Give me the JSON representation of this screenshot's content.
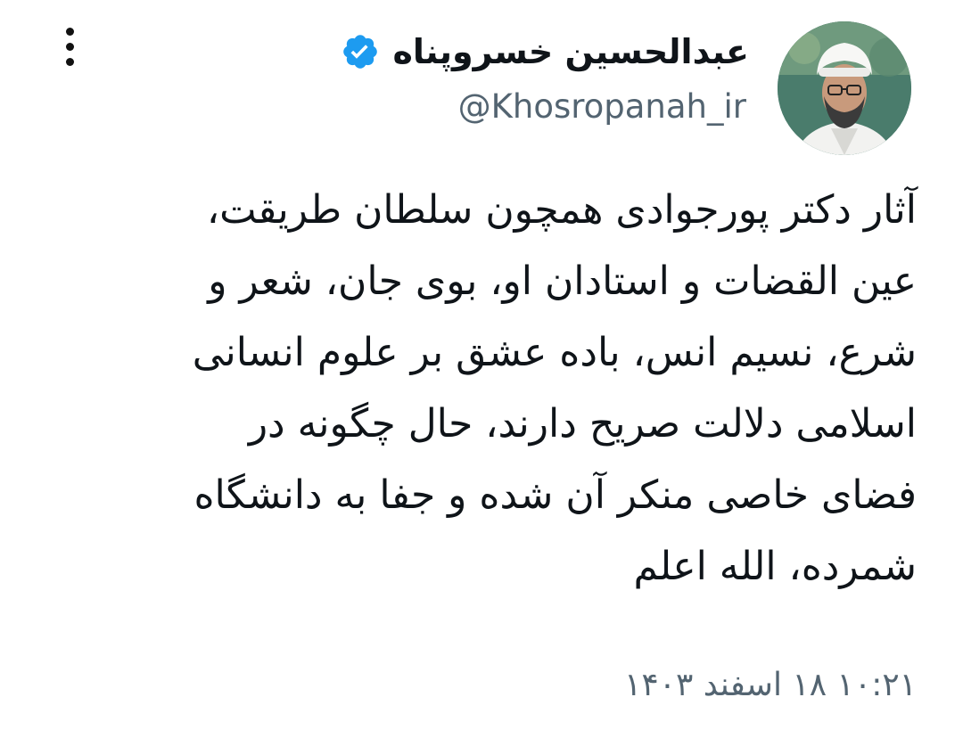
{
  "author": {
    "display_name": "عبدالحسین خسروپناه",
    "handle": "@Khosropanah_ir",
    "verified": true
  },
  "tweet": {
    "lines": [
      "آثار دکتر پورجوادی همچون سلطان طریقت،",
      "عین القضات و استادان او، بوی جان، شعر و",
      "شرع، نسیم انس، باده عشق بر علوم انسانی",
      "اسلامی دلالت صریح دارند، حال چگونه در",
      "فضای خاصی منکر آن شده و جفا به دانشگاه",
      "شمرده، الله اعلم"
    ]
  },
  "timestamp": "۱۰:۲۱ ۱۸ اسفند ۱۴۰۳",
  "icons": {
    "verified": "verified-badge-icon",
    "more": "more-vertical-icon"
  },
  "colors": {
    "text": "#0f1419",
    "secondary": "#536471",
    "verified": "#1d9bf0",
    "background": "#ffffff"
  }
}
